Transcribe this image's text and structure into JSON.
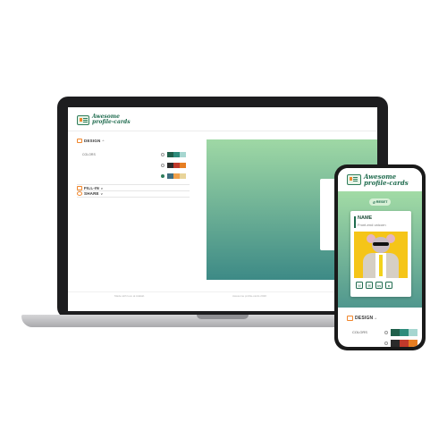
{
  "app": {
    "logo_text": "Awesome\nprofile-cards"
  },
  "sidebar": {
    "design_label": "DESIGN",
    "colors_label": "COLORS",
    "fillin_label": "FILL-IN",
    "share_label": "SHARE",
    "palettes": [
      {
        "selected": false,
        "colors": [
          "#1f5f4a",
          "#2e8c7c",
          "#a6d6d0"
        ]
      },
      {
        "selected": false,
        "colors": [
          "#2b2b2b",
          "#c0392b",
          "#e67e22"
        ]
      },
      {
        "selected": true,
        "colors": [
          "#3f6e80",
          "#f0a04b",
          "#e8d49a"
        ]
      }
    ]
  },
  "card": {
    "reset_label": "RESET",
    "name": "NAME",
    "role": "Front-end unicorn"
  },
  "footer": {
    "left": "Made with love at Adalab",
    "right": "Awesome profile-cards 2020"
  },
  "colors": {
    "brand": "#1f6b4e",
    "accent": "#f0862c",
    "preview_top": "#9fd8a5",
    "preview_bottom": "#3d8a86"
  },
  "icons": [
    "palette-icon",
    "keyboard-icon",
    "share-icon",
    "reset-icon",
    "phone-icon",
    "mail-icon",
    "linkedin-icon",
    "github-icon"
  ]
}
